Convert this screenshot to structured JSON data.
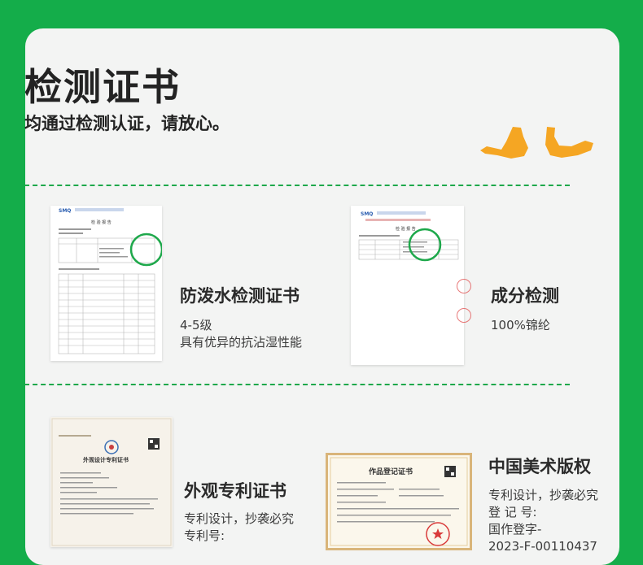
{
  "header": {
    "title": "检测证书",
    "subtitle": "均通过检测认证，请放心。"
  },
  "colors": {
    "brand_green": "#14ad4a",
    "accent_orange": "#f5a623",
    "circle_green": "#1ea84b"
  },
  "reports": [
    {
      "title": "防泼水检测证书",
      "lines": [
        "4-5级",
        "具有优异的抗沾湿性能"
      ],
      "doc_heading": "检 验 报 告",
      "logo": "SMQ"
    },
    {
      "title": "成分检测",
      "lines": [
        "100%锦纶"
      ],
      "doc_heading": "检 验 报 告",
      "logo": "SMQ"
    },
    {
      "title": "外观专利证书",
      "lines": [
        "专利设计，抄袭必究",
        "专利号:"
      ],
      "doc_heading": "外观设计专利证书"
    },
    {
      "title": "中国美术版权",
      "lines": [
        "专利设计，抄袭必究",
        "登 记 号:",
        "国作登字-",
        "2023-F-00110437"
      ],
      "doc_heading": "作品登记证书"
    }
  ]
}
